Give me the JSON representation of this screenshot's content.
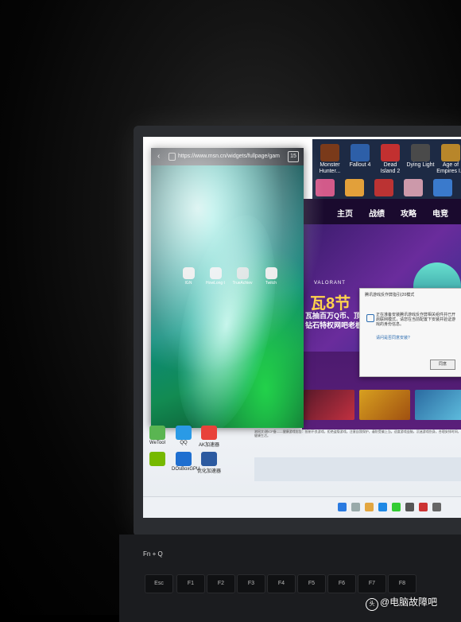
{
  "browser": {
    "url": "https://www.msn.cn/widgets/fullpage/gam",
    "tab_count": "15"
  },
  "phone_apps": [
    "IGN",
    "HowLong t",
    "TrueAchiev",
    "Twitch"
  ],
  "games": [
    {
      "name": "Monster Hunter...",
      "color": "#7a3a1a"
    },
    {
      "name": "Fallout 4",
      "color": "#2d5fa8"
    },
    {
      "name": "Dead Island 2",
      "color": "#c23030"
    },
    {
      "name": "Dying Light",
      "color": "#4a4a4a"
    },
    {
      "name": "Age of Empires I...",
      "color": "#b8862a"
    }
  ],
  "site": {
    "nav": [
      "主页",
      "战绩",
      "攻略",
      "电竞"
    ],
    "valorant": "VALORANT",
    "headline": "瓦8节",
    "sub1": "瓦抽百万Q币、顶",
    "sub2": "钻石特权网吧老板"
  },
  "dialog": {
    "title": "腾讯游戏反作弊指引(20模式",
    "body": "正在准备安装腾讯游戏反作弊相关组件并已开启联网模式，请您在当前配置下安装并验证游戏的身份信息。",
    "question": "请问是否同意安装?",
    "button": "同意"
  },
  "desktop_icons": [
    "WeTool",
    "QQ",
    "AK加速器",
    "",
    "DOsBoxGPU",
    "优化加速器"
  ],
  "info_text": "湘网文/湘ICP备——健康游戏忠告：抵制不良游戏，拒绝盗版游戏。注意自我保护，谨防受骗上当。适度游戏益脑，沉迷游戏伤身。合理安排时间，享受健康生活。",
  "watermark": "@电脑故障吧",
  "keyboard": {
    "fn": "Fn",
    "q": "Q",
    "esc": "Esc",
    "keys": [
      "F1",
      "F2",
      "F3",
      "F4",
      "F5",
      "F6",
      "F7",
      "F8"
    ]
  }
}
